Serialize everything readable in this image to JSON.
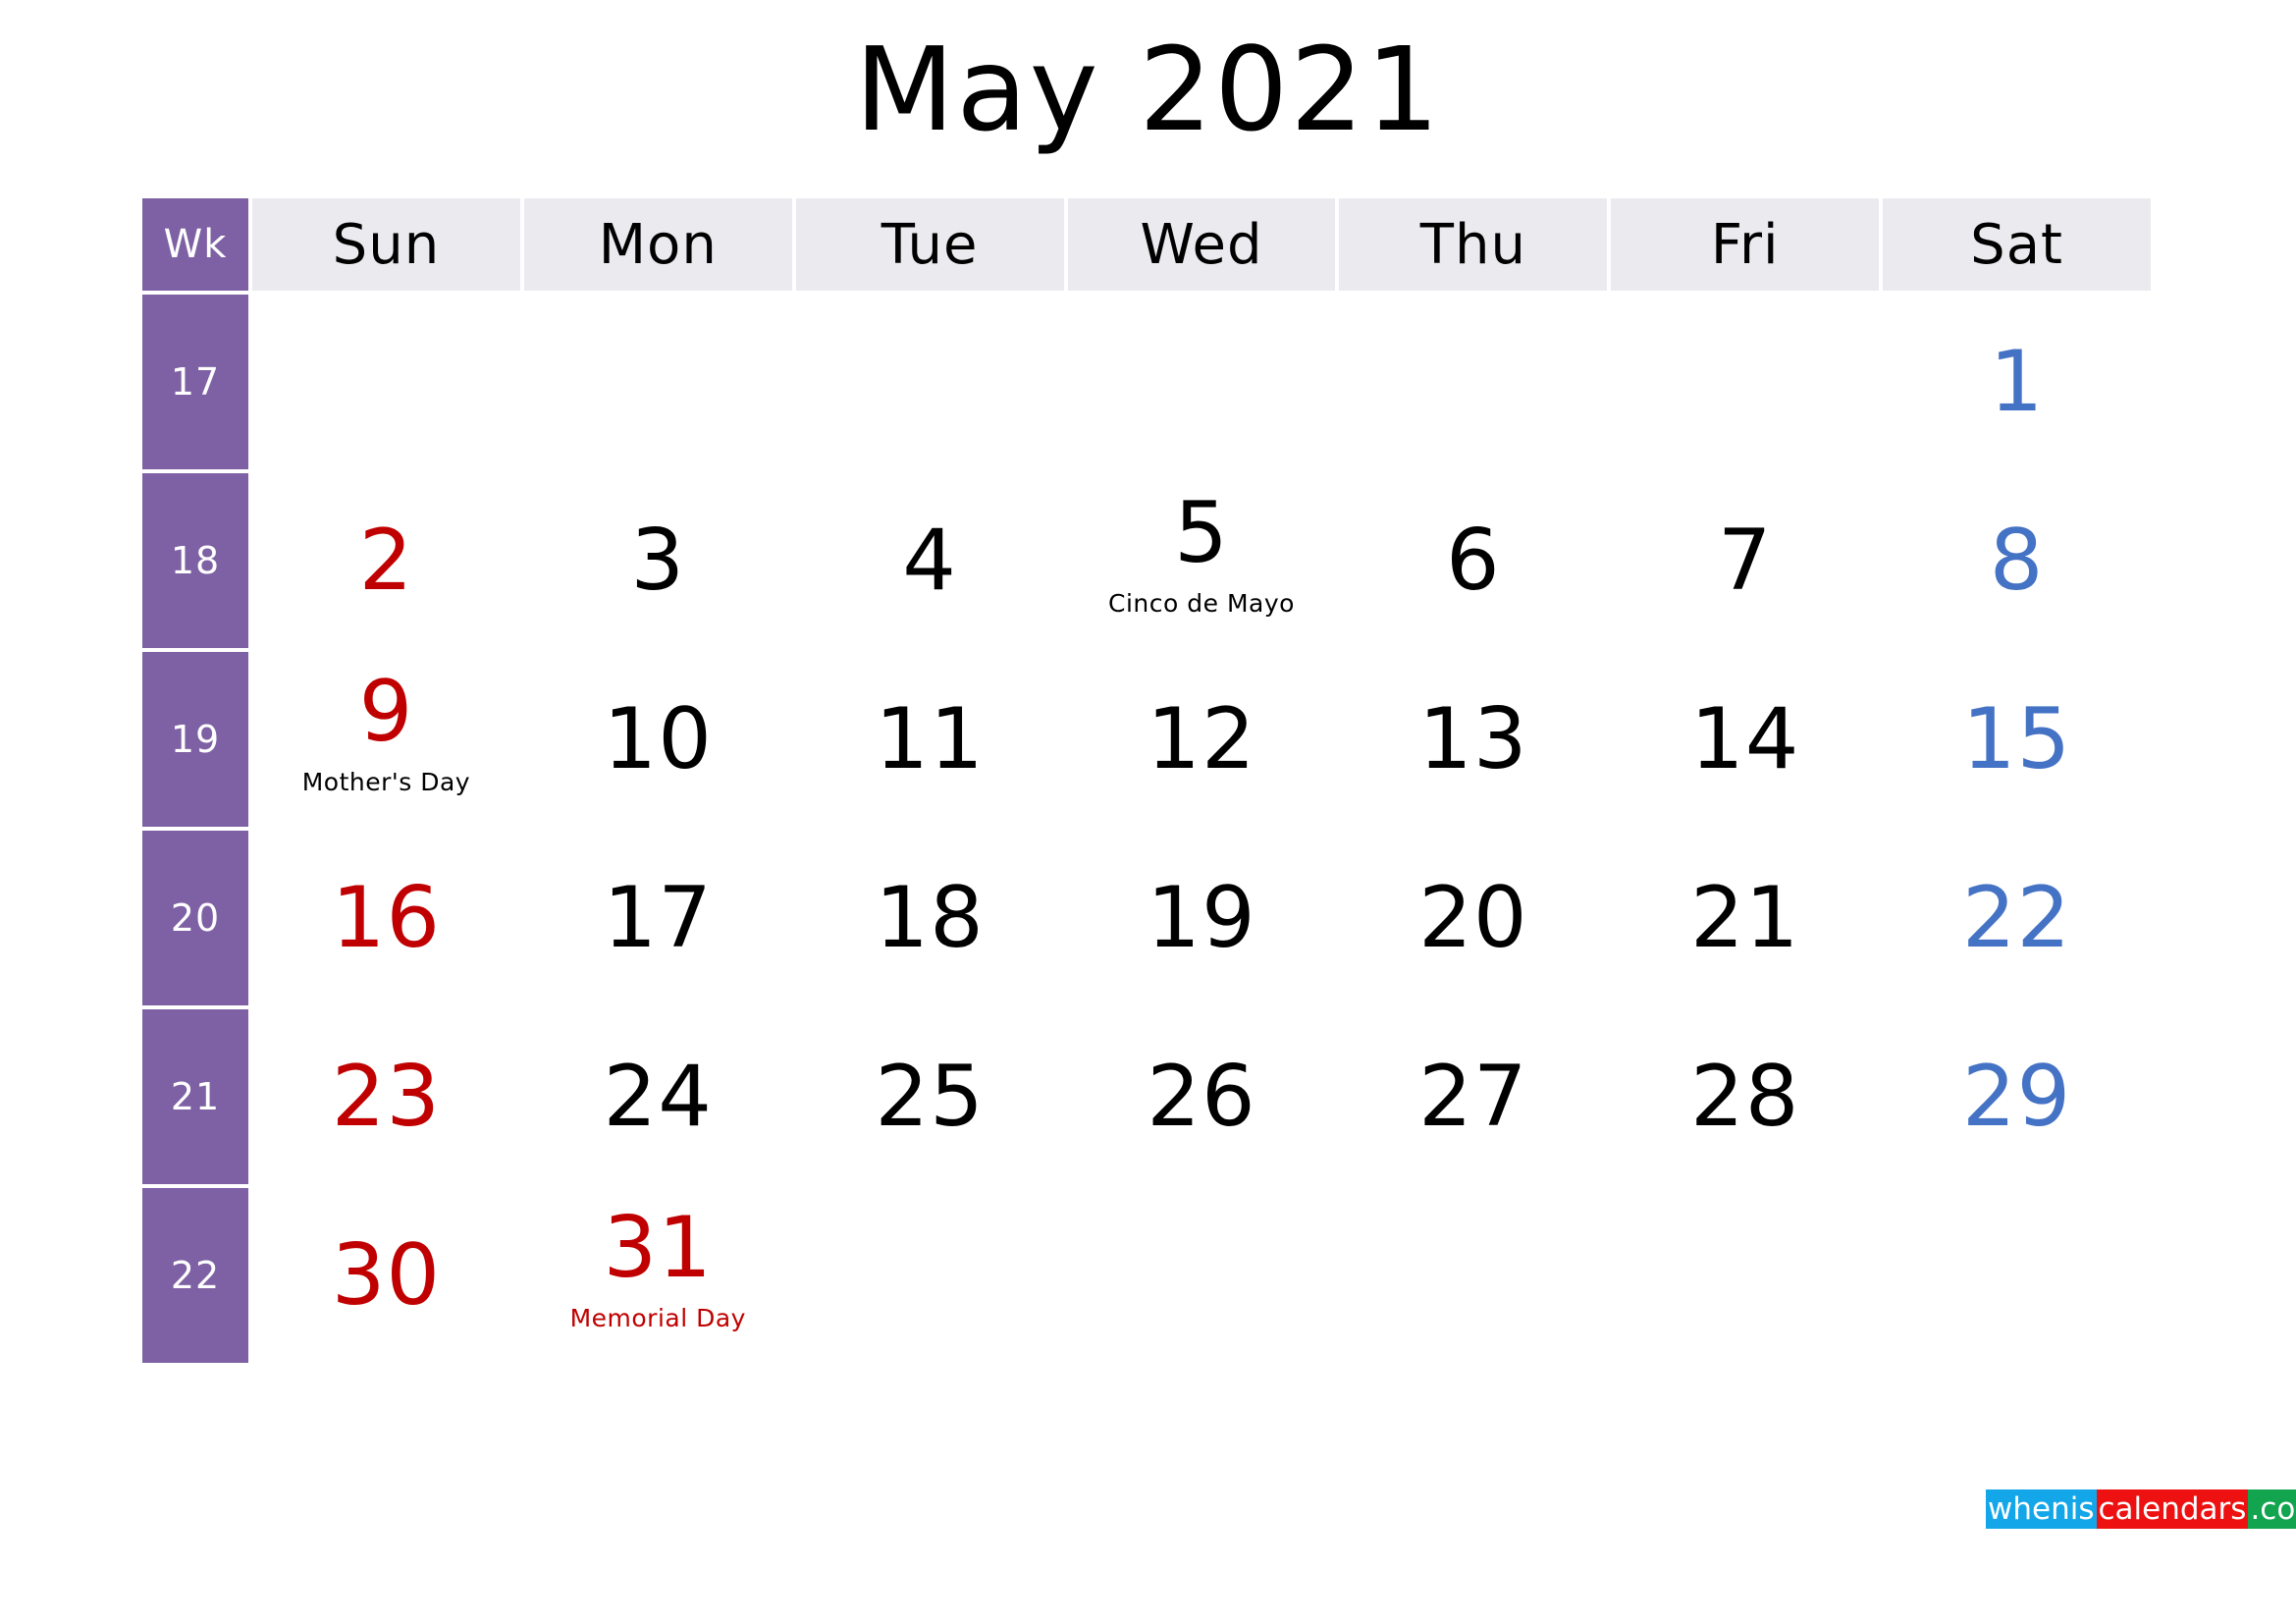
{
  "title": "May 2021",
  "month": "May",
  "year": "2021",
  "header": {
    "week_label": "Wk",
    "days": [
      "Sun",
      "Mon",
      "Tue",
      "Wed",
      "Thu",
      "Fri",
      "Sat"
    ]
  },
  "colors": {
    "week_column_bg": "#7e60a4",
    "header_bg": "#ebeaef",
    "sunday_text": "#c00000",
    "saturday_text": "#4472c4",
    "weekday_text": "#000000",
    "holiday_text": "#c00000",
    "logo_blue": "#13a6e8",
    "logo_red": "#ee1111",
    "logo_green": "#12a44e"
  },
  "weeks": [
    {
      "wk": "17",
      "days": [
        {
          "num": "",
          "note": "",
          "kind": "empty"
        },
        {
          "num": "",
          "note": "",
          "kind": "empty"
        },
        {
          "num": "",
          "note": "",
          "kind": "empty"
        },
        {
          "num": "",
          "note": "",
          "kind": "empty"
        },
        {
          "num": "",
          "note": "",
          "kind": "empty"
        },
        {
          "num": "",
          "note": "",
          "kind": "empty"
        },
        {
          "num": "1",
          "note": "",
          "kind": "sat"
        }
      ]
    },
    {
      "wk": "18",
      "days": [
        {
          "num": "2",
          "note": "",
          "kind": "sun"
        },
        {
          "num": "3",
          "note": "",
          "kind": "weekday"
        },
        {
          "num": "4",
          "note": "",
          "kind": "weekday"
        },
        {
          "num": "5",
          "note": "Cinco de Mayo",
          "kind": "weekday"
        },
        {
          "num": "6",
          "note": "",
          "kind": "weekday"
        },
        {
          "num": "7",
          "note": "",
          "kind": "weekday"
        },
        {
          "num": "8",
          "note": "",
          "kind": "sat"
        }
      ]
    },
    {
      "wk": "19",
      "days": [
        {
          "num": "9",
          "note": "Mother's Day",
          "kind": "sun"
        },
        {
          "num": "10",
          "note": "",
          "kind": "weekday"
        },
        {
          "num": "11",
          "note": "",
          "kind": "weekday"
        },
        {
          "num": "12",
          "note": "",
          "kind": "weekday"
        },
        {
          "num": "13",
          "note": "",
          "kind": "weekday"
        },
        {
          "num": "14",
          "note": "",
          "kind": "weekday"
        },
        {
          "num": "15",
          "note": "",
          "kind": "sat"
        }
      ]
    },
    {
      "wk": "20",
      "days": [
        {
          "num": "16",
          "note": "",
          "kind": "sun"
        },
        {
          "num": "17",
          "note": "",
          "kind": "weekday"
        },
        {
          "num": "18",
          "note": "",
          "kind": "weekday"
        },
        {
          "num": "19",
          "note": "",
          "kind": "weekday"
        },
        {
          "num": "20",
          "note": "",
          "kind": "weekday"
        },
        {
          "num": "21",
          "note": "",
          "kind": "weekday"
        },
        {
          "num": "22",
          "note": "",
          "kind": "sat"
        }
      ]
    },
    {
      "wk": "21",
      "days": [
        {
          "num": "23",
          "note": "",
          "kind": "sun"
        },
        {
          "num": "24",
          "note": "",
          "kind": "weekday"
        },
        {
          "num": "25",
          "note": "",
          "kind": "weekday"
        },
        {
          "num": "26",
          "note": "",
          "kind": "weekday"
        },
        {
          "num": "27",
          "note": "",
          "kind": "weekday"
        },
        {
          "num": "28",
          "note": "",
          "kind": "weekday"
        },
        {
          "num": "29",
          "note": "",
          "kind": "sat"
        }
      ]
    },
    {
      "wk": "22",
      "days": [
        {
          "num": "30",
          "note": "",
          "kind": "sun"
        },
        {
          "num": "31",
          "note": "Memorial Day",
          "kind": "holiday"
        },
        {
          "num": "",
          "note": "",
          "kind": "empty"
        },
        {
          "num": "",
          "note": "",
          "kind": "empty"
        },
        {
          "num": "",
          "note": "",
          "kind": "empty"
        },
        {
          "num": "",
          "note": "",
          "kind": "empty"
        },
        {
          "num": "",
          "note": "",
          "kind": "empty"
        }
      ]
    }
  ],
  "logo": {
    "segment_1": "whenis",
    "segment_2": "calendars",
    "segment_3": ".com"
  }
}
